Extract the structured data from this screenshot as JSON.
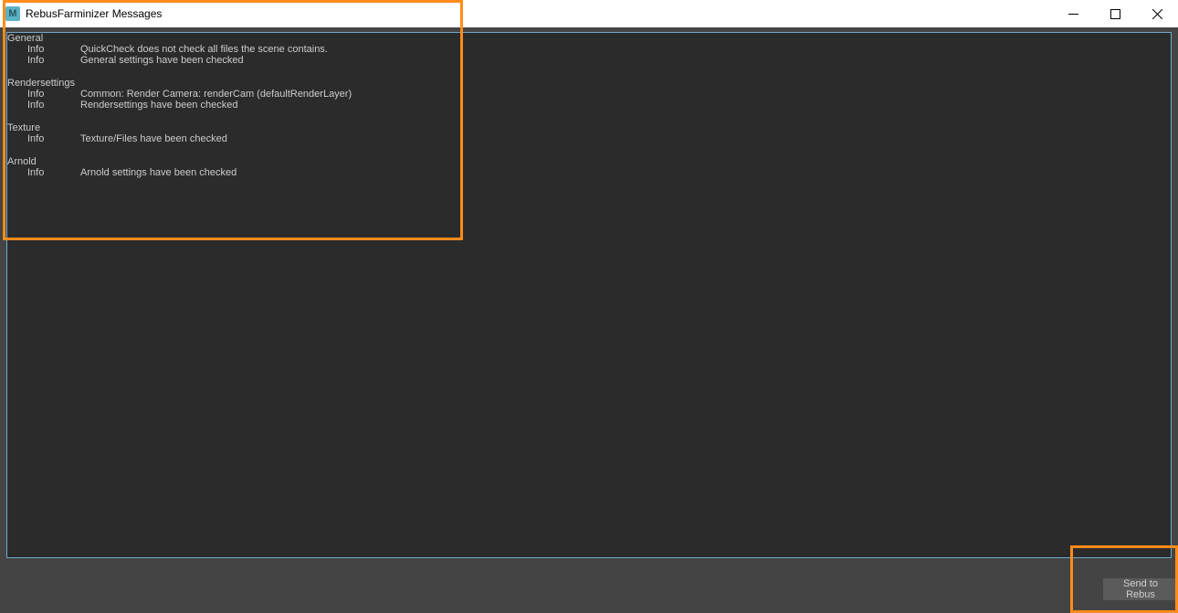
{
  "window": {
    "title": "RebusFarminizer Messages"
  },
  "log": {
    "sections": [
      {
        "header": "General",
        "rows": [
          {
            "level": "Info",
            "message": "QuickCheck does not check all files the scene contains."
          },
          {
            "level": "Info",
            "message": "General settings have been checked"
          }
        ]
      },
      {
        "header": "Rendersettings",
        "rows": [
          {
            "level": "Info",
            "message": "Common: Render Camera: renderCam (defaultRenderLayer)"
          },
          {
            "level": "Info",
            "message": "Rendersettings have been checked"
          }
        ]
      },
      {
        "header": "Texture",
        "rows": [
          {
            "level": "Info",
            "message": "Texture/Files have been checked"
          }
        ]
      },
      {
        "header": "Arnold",
        "rows": [
          {
            "level": "Info",
            "message": "Arnold settings have been checked"
          }
        ]
      }
    ]
  },
  "footer": {
    "send_label": "Send to Rebus"
  }
}
